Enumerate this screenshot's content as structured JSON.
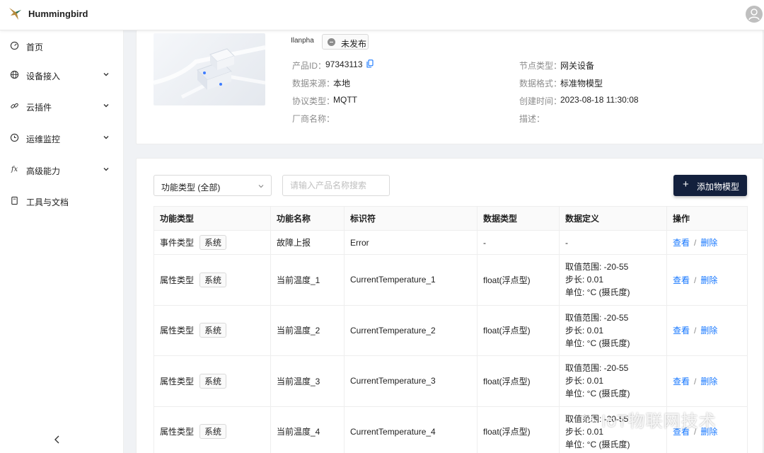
{
  "header": {
    "app_title": "Hummingbird"
  },
  "sidebar": {
    "items": [
      {
        "label": "首页",
        "icon": "dashboard-icon",
        "expandable": false
      },
      {
        "label": "设备接入",
        "icon": "globe-icon",
        "expandable": true
      },
      {
        "label": "云插件",
        "icon": "link-icon",
        "expandable": true
      },
      {
        "label": "运维监控",
        "icon": "clock-icon",
        "expandable": true
      },
      {
        "label": "高级能力",
        "icon": "fx-icon",
        "expandable": true
      },
      {
        "label": "工具与文档",
        "icon": "document-icon",
        "expandable": false
      }
    ]
  },
  "product": {
    "name": "Ilanpha",
    "status": "未发布",
    "fields": {
      "product_id_label": "产品ID：",
      "product_id": "97343113",
      "data_source_label": "数据来源：",
      "data_source": "本地",
      "protocol_label": "协议类型：",
      "protocol": "MQTT",
      "vendor_label": "厂商名称：",
      "vendor": "",
      "node_type_label": "节点类型：",
      "node_type": "网关设备",
      "data_format_label": "数据格式：",
      "data_format": "标准物模型",
      "created_label": "创建时间：",
      "created": "2023-08-18 11:30:08",
      "desc_label": "描述：",
      "desc": ""
    }
  },
  "toolbar": {
    "filter_value": "功能类型 (全部)",
    "search_placeholder": "请输入产品名称搜索",
    "add_label": "添加物模型"
  },
  "table": {
    "headers": [
      "功能类型",
      "功能名称",
      "标识符",
      "数据类型",
      "数据定义",
      "操作"
    ],
    "rows": [
      {
        "type": "事件类型",
        "tag": "系统",
        "name": "故障上报",
        "identifier": "Error",
        "datatype": "-",
        "def": [
          "-"
        ],
        "view": "查看",
        "delete": "删除"
      },
      {
        "type": "属性类型",
        "tag": "系统",
        "name": "当前温度_1",
        "identifier": "CurrentTemperature_1",
        "datatype": "float(浮点型)",
        "def": [
          "取值范围: -20-55",
          "步长: 0.01",
          "单位: °C (摄氏度)"
        ],
        "view": "查看",
        "delete": "删除"
      },
      {
        "type": "属性类型",
        "tag": "系统",
        "name": "当前温度_2",
        "identifier": "CurrentTemperature_2",
        "datatype": "float(浮点型)",
        "def": [
          "取值范围: -20-55",
          "步长: 0.01",
          "单位: °C (摄氏度)"
        ],
        "view": "查看",
        "delete": "删除"
      },
      {
        "type": "属性类型",
        "tag": "系统",
        "name": "当前温度_3",
        "identifier": "CurrentTemperature_3",
        "datatype": "float(浮点型)",
        "def": [
          "取值范围: -20-55",
          "步长: 0.01",
          "单位: °C (摄氏度)"
        ],
        "view": "查看",
        "delete": "删除"
      },
      {
        "type": "属性类型",
        "tag": "系统",
        "name": "当前温度_4",
        "identifier": "CurrentTemperature_4",
        "datatype": "float(浮点型)",
        "def": [
          "取值范围: -20-55",
          "步长: 0.01",
          "单位: °C (摄氏度)"
        ],
        "view": "查看",
        "delete": "删除"
      }
    ],
    "separator": "/"
  },
  "watermark": {
    "text": "IoT物联网技术"
  },
  "colors": {
    "primary_button": "#13203d",
    "link": "#1677ff"
  }
}
